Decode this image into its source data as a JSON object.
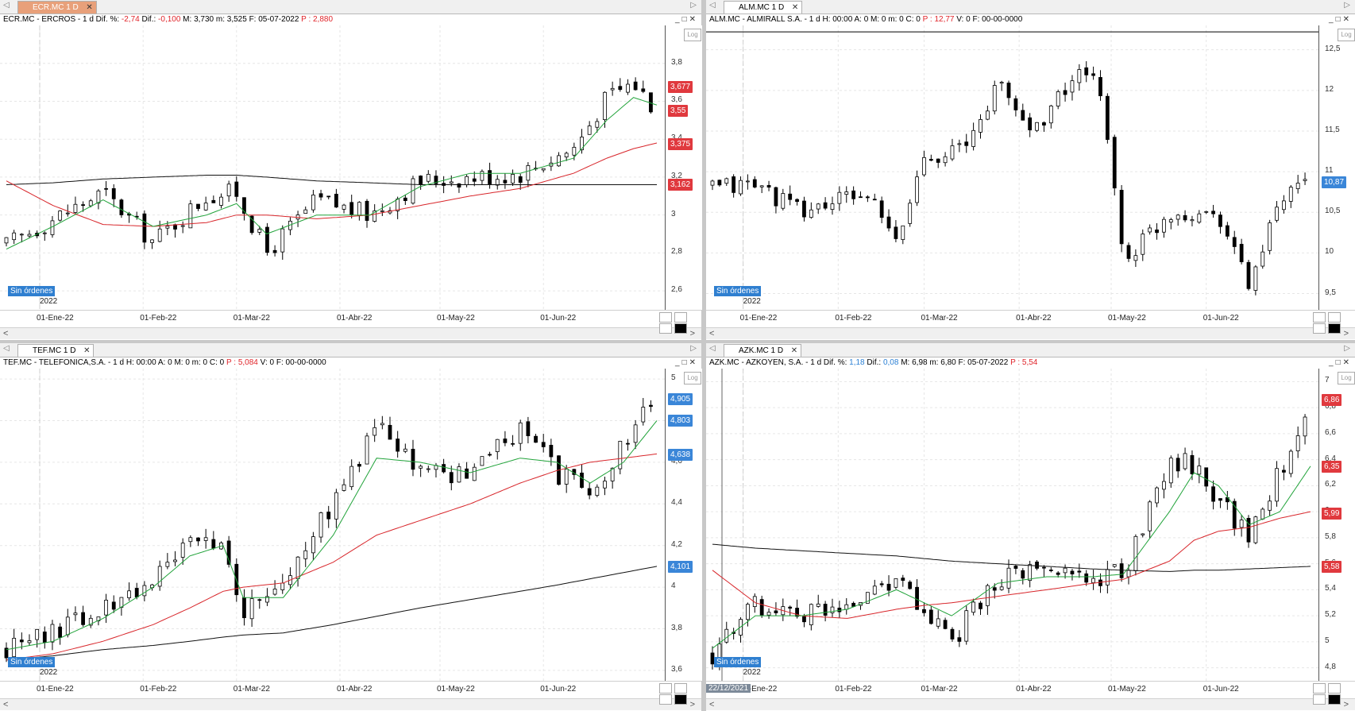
{
  "panels": [
    {
      "id": "ecr",
      "tab": "ECR.MC 1 D",
      "tab_active": true,
      "info": {
        "a": "ECR.MC - ERCROS -  1 d  Dif. %: ",
        "dif_pct": "-2,74",
        "b": "  Dif.: ",
        "dif": "-0,100",
        "c": "  M: 3,730  m: 3,525  F: 05-07-2022  ",
        "p_label": "P : 2,880",
        "d": ""
      },
      "log_label": "Log",
      "badge": "Sin órdenes",
      "year_label": "2022",
      "cursor_date": "",
      "xticks": [
        "01-Ene-22",
        "01-Feb-22",
        "01-Mar-22",
        "01-Abr-22",
        "01-May-22",
        "01-Jun-22"
      ],
      "yticks": [
        "3,8",
        "3,6",
        "3,4",
        "3,2",
        "3",
        "2,8",
        "2,6"
      ],
      "price_tags": [
        {
          "text": "3,677",
          "color": "#e0393e"
        },
        {
          "text": "3,55",
          "color": "#e0393e"
        },
        {
          "text": "3,375",
          "color": "#e0393e"
        },
        {
          "text": "3,162",
          "color": "#e0393e"
        }
      ]
    },
    {
      "id": "alm",
      "tab": "ALM.MC 1 D",
      "tab_active": false,
      "info": {
        "a": "ALM.MC - ALMIRALL S.A.  -  1 d  H: 00:00  A: 0  M: 0  m: 0  C: 0  ",
        "dif_pct": "",
        "b": "",
        "dif": "",
        "c": "",
        "p_label": "P : 12,77",
        "d": "  V: 0  F: 00-00-0000"
      },
      "log_label": "Log",
      "badge": "Sin órdenes",
      "year_label": "2022",
      "cursor_date": "",
      "xticks": [
        "01-Ene-22",
        "01-Feb-22",
        "01-Mar-22",
        "01-Abr-22",
        "01-May-22",
        "01-Jun-22"
      ],
      "yticks": [
        "12,5",
        "12",
        "11,5",
        "11",
        "10,5",
        "10",
        "9,5"
      ],
      "price_tags": [
        {
          "text": "10,87",
          "color": "#3a86d8"
        }
      ]
    },
    {
      "id": "tef",
      "tab": "TEF.MC 1 D",
      "tab_active": false,
      "info": {
        "a": "TEF.MC - TELEFONICA,S.A.  -  1 d  H: 00:00  A: 0  M: 0  m: 0  C: 0  ",
        "dif_pct": "",
        "b": "",
        "dif": "",
        "c": "",
        "p_label": "P : 5,084",
        "d": "  V: 0  F: 00-00-0000"
      },
      "log_label": "Log",
      "badge": "Sin órdenes",
      "year_label": "2022",
      "cursor_date": "",
      "xticks": [
        "01-Ene-22",
        "01-Feb-22",
        "01-Mar-22",
        "01-Abr-22",
        "01-May-22",
        "01-Jun-22"
      ],
      "yticks": [
        "5",
        "4,8",
        "4,6",
        "4,4",
        "4,2",
        "4",
        "3,8",
        "3,6"
      ],
      "price_tags": [
        {
          "text": "4,905",
          "color": "#3a86d8"
        },
        {
          "text": "4,803",
          "color": "#3a86d8"
        },
        {
          "text": "4,638",
          "color": "#3a86d8"
        },
        {
          "text": "4,101",
          "color": "#3a86d8"
        }
      ]
    },
    {
      "id": "azk",
      "tab": "AZK.MC 1 D",
      "tab_active": false,
      "info": {
        "a": "AZK.MC - AZKOYEN, S.A.  -  1 d  Dif. %: ",
        "dif_pct": "1,18",
        "b": "  Dif.: ",
        "dif": "0,08",
        "c": "  M: 6,98  m: 6,80  F: 05-07-2022  ",
        "p_label": "P : 5,54",
        "d": ""
      },
      "log_label": "Log",
      "badge": "Sin órdenes",
      "year_label": "2022",
      "cursor_date": "22/12/2021",
      "xticks": [
        "01-Ene-22",
        "01-Feb-22",
        "01-Mar-22",
        "01-Abr-22",
        "01-May-22",
        "01-Jun-22"
      ],
      "yticks": [
        "7",
        "6,8",
        "6,6",
        "6,4",
        "6,2",
        "6",
        "5,8",
        "5,6",
        "5,4",
        "5,2",
        "5",
        "4,8"
      ],
      "price_tags": [
        {
          "text": "6,86",
          "color": "#e0393e"
        },
        {
          "text": "6,35",
          "color": "#e0393e"
        },
        {
          "text": "5,99",
          "color": "#e0393e"
        },
        {
          "text": "5,58",
          "color": "#e0393e"
        }
      ]
    }
  ],
  "chart_data": [
    {
      "type": "candlestick",
      "title": "ECR.MC - ERCROS",
      "period": "1 d",
      "x_range": [
        "2021-12-22",
        "2022-07-05"
      ],
      "x": [
        "2021-12-22",
        "2022-01-05",
        "2022-01-20",
        "2022-02-04",
        "2022-02-20",
        "2022-03-01",
        "2022-03-10",
        "2022-03-25",
        "2022-04-10",
        "2022-04-25",
        "2022-05-10",
        "2022-05-25",
        "2022-06-10",
        "2022-06-20",
        "2022-06-28",
        "2022-07-05"
      ],
      "close": [
        2.84,
        2.98,
        3.12,
        2.86,
        3.1,
        3.12,
        2.8,
        3.08,
        3.0,
        3.18,
        3.2,
        3.22,
        3.35,
        3.62,
        3.7,
        3.55
      ],
      "ema_fast": [
        2.82,
        2.94,
        3.08,
        2.94,
        3.0,
        3.06,
        2.9,
        3.0,
        3.0,
        3.15,
        3.22,
        3.22,
        3.3,
        3.5,
        3.62,
        3.58
      ],
      "ema_slow": [
        3.18,
        3.05,
        2.95,
        2.94,
        2.96,
        3.0,
        3.0,
        2.98,
        3.0,
        3.05,
        3.1,
        3.14,
        3.22,
        3.3,
        3.35,
        3.38
      ],
      "long_ma": [
        3.16,
        3.17,
        3.19,
        3.2,
        3.21,
        3.21,
        3.2,
        3.18,
        3.17,
        3.16,
        3.16,
        3.16,
        3.16,
        3.16,
        3.16,
        3.16
      ],
      "ylim": [
        2.5,
        4.0
      ],
      "ylabel_side": "right",
      "log_scale": false
    },
    {
      "type": "candlestick",
      "title": "ALM.MC - ALMIRALL S.A.",
      "period": "1 d",
      "x_range": [
        "2021-12-22",
        "2022-07-05"
      ],
      "x": [
        "2021-12-22",
        "2022-01-05",
        "2022-01-20",
        "2022-01-28",
        "2022-02-10",
        "2022-02-20",
        "2022-03-01",
        "2022-03-15",
        "2022-03-25",
        "2022-04-05",
        "2022-04-20",
        "2022-04-28",
        "2022-05-05",
        "2022-05-20",
        "2022-06-05",
        "2022-06-15",
        "2022-06-25",
        "2022-07-05"
      ],
      "close": [
        10.8,
        10.85,
        10.5,
        10.6,
        10.75,
        10.1,
        11.2,
        11.3,
        12.1,
        11.5,
        12.2,
        12.0,
        9.9,
        10.5,
        10.5,
        9.6,
        10.6,
        10.87
      ],
      "ylim": [
        9.3,
        12.8
      ],
      "ylabel_side": "right",
      "log_scale": false
    },
    {
      "type": "candlestick",
      "title": "TEF.MC - TELEFONICA,S.A.",
      "period": "1 d",
      "x_range": [
        "2021-12-22",
        "2022-07-05"
      ],
      "x": [
        "2021-12-22",
        "2022-01-05",
        "2022-01-20",
        "2022-02-04",
        "2022-02-15",
        "2022-02-25",
        "2022-03-03",
        "2022-03-15",
        "2022-03-30",
        "2022-04-12",
        "2022-04-25",
        "2022-05-10",
        "2022-05-25",
        "2022-06-05",
        "2022-06-15",
        "2022-06-25",
        "2022-07-05"
      ],
      "close": [
        3.7,
        3.78,
        3.9,
        4.05,
        4.22,
        4.18,
        3.85,
        4.05,
        4.4,
        4.78,
        4.55,
        4.55,
        4.75,
        4.55,
        4.45,
        4.7,
        4.9
      ],
      "ema_fast": [
        3.7,
        3.74,
        3.85,
        4.0,
        4.15,
        4.2,
        3.95,
        3.95,
        4.25,
        4.62,
        4.6,
        4.55,
        4.62,
        4.6,
        4.5,
        4.6,
        4.8
      ],
      "ema_slow": [
        3.65,
        3.68,
        3.74,
        3.82,
        3.9,
        3.98,
        4.0,
        4.02,
        4.12,
        4.25,
        4.32,
        4.4,
        4.5,
        4.56,
        4.6,
        4.62,
        4.64
      ],
      "long_ma": [
        3.65,
        3.67,
        3.7,
        3.72,
        3.74,
        3.76,
        3.77,
        3.78,
        3.82,
        3.86,
        3.9,
        3.94,
        3.98,
        4.01,
        4.04,
        4.07,
        4.1
      ],
      "ylim": [
        3.55,
        5.05
      ],
      "ylabel_side": "right",
      "log_scale": false
    },
    {
      "type": "candlestick",
      "title": "AZK.MC - AZKOYEN, S.A.",
      "period": "1 d",
      "x_range": [
        "2021-12-22",
        "2022-07-05"
      ],
      "x": [
        "2021-12-22",
        "2022-01-05",
        "2022-01-20",
        "2022-02-04",
        "2022-02-20",
        "2022-03-01",
        "2022-03-10",
        "2022-03-25",
        "2022-04-10",
        "2022-04-25",
        "2022-05-05",
        "2022-05-20",
        "2022-05-28",
        "2022-06-05",
        "2022-06-15",
        "2022-06-25",
        "2022-07-05"
      ],
      "close": [
        4.9,
        5.3,
        5.2,
        5.3,
        5.5,
        5.2,
        5.0,
        5.5,
        5.55,
        5.5,
        5.52,
        6.4,
        6.35,
        6.1,
        5.8,
        6.3,
        6.86
      ],
      "ema_fast": [
        4.95,
        5.2,
        5.2,
        5.25,
        5.4,
        5.3,
        5.2,
        5.45,
        5.5,
        5.5,
        5.52,
        6.0,
        6.3,
        6.2,
        5.9,
        6.0,
        6.35
      ],
      "ema_slow": [
        5.55,
        5.3,
        5.2,
        5.18,
        5.25,
        5.28,
        5.3,
        5.35,
        5.4,
        5.45,
        5.48,
        5.62,
        5.78,
        5.85,
        5.88,
        5.95,
        6.0
      ],
      "long_ma": [
        5.75,
        5.72,
        5.7,
        5.68,
        5.66,
        5.64,
        5.62,
        5.6,
        5.58,
        5.56,
        5.55,
        5.54,
        5.55,
        5.55,
        5.56,
        5.57,
        5.58
      ],
      "ylim": [
        4.7,
        7.1
      ],
      "ylabel_side": "right",
      "log_scale": false
    }
  ]
}
